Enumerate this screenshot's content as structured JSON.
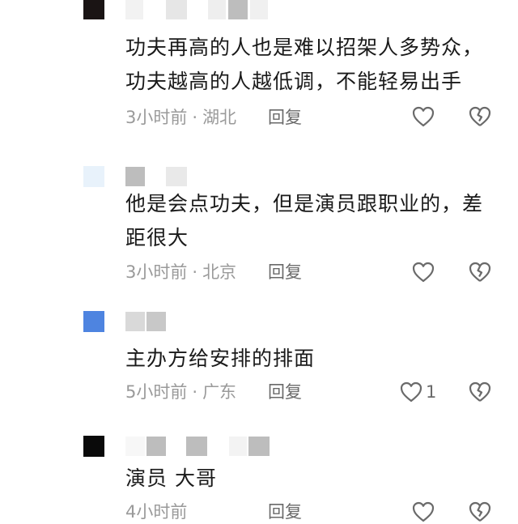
{
  "comments": [
    {
      "avatar_color": "#1a1414",
      "name_blocks": [
        "#f2f2f2",
        "#e6e6e6",
        "#eeeeee",
        "#bdbdbd",
        "#f0f0f0"
      ],
      "text_lines": [
        "功夫再高的人也是难以招架人多势众，",
        "功夫越高的人越低调，不能轻易出手"
      ],
      "time": "3小时前",
      "region": "湖北",
      "reply_label": "回复",
      "like_count": ""
    },
    {
      "avatar_color": "#e8f2fb",
      "name_blocks": [
        "#bdbdbd",
        "#e9e9e9"
      ],
      "text_lines": [
        "他是会点功夫，但是演员跟职业的，差",
        "距很大"
      ],
      "time": "3小时前",
      "region": "北京",
      "reply_label": "回复",
      "like_count": ""
    },
    {
      "avatar_color": "#4e84e0",
      "name_blocks": [
        "#d9d9d9",
        "#c8c8c8"
      ],
      "text_lines": [
        "主办方给安排的排面"
      ],
      "time": "5小时前",
      "region": "广东",
      "reply_label": "回复",
      "like_count": "1"
    },
    {
      "avatar_color": "#0a0a0a",
      "name_blocks": [
        "#f7f7f7",
        "#bdbdbd",
        "#bdbdbd",
        "#f3f3f3",
        "#bdbdbd"
      ],
      "text_lines": [
        "演员 大哥"
      ],
      "time": "4小时前",
      "region": "",
      "reply_label": "回复",
      "like_count": ""
    }
  ],
  "icons": {
    "like": "heart-outline-icon",
    "dislike": "broken-heart-icon"
  },
  "colors": {
    "body_text": "#1a1a1a",
    "meta_text": "#9a9a9a",
    "icon": "#6a6a6a"
  }
}
